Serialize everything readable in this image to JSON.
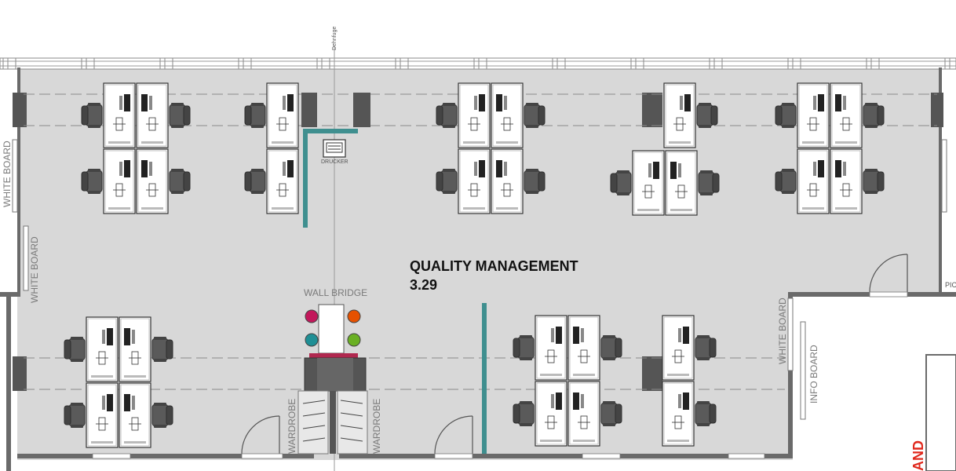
{
  "room": {
    "name": "QUALITY MANAGEMENT",
    "number": "3.29"
  },
  "labels": {
    "expansion_joint": "Dehnfuge",
    "printer": "DRUCKER",
    "wall_bridge": "WALL BRIDGE",
    "whiteboard_1": "WHITE BOARD",
    "whiteboard_2": "WHITE BOARD",
    "whiteboard_3": "WHITE BOARD",
    "info_board": "INFO BOARD",
    "wardrobe_left": "WARDROBE",
    "wardrobe_right": "WARDROBE",
    "edge_pic": "PIC",
    "edge_red": "AND"
  },
  "colors": {
    "floor": "#d8d8d8",
    "wall": "#6a6a6a",
    "partition": "#3f8f8f",
    "chair": "#5a5a5a",
    "desk": "#ffffff",
    "bridge_dot_magenta": "#c2185b",
    "bridge_dot_orange": "#e65100",
    "bridge_dot_teal": "#1f8f95",
    "bridge_dot_green": "#6ab023",
    "bridge_bar": "#b0284f",
    "edge_red": "#e0281c"
  }
}
